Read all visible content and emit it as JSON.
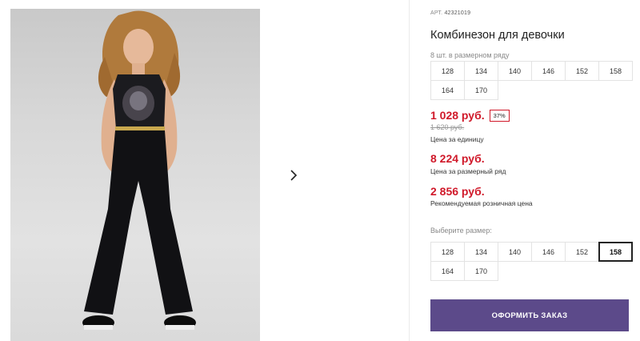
{
  "gallery": {
    "next_icon": "chevron-right-icon"
  },
  "product": {
    "art_label": "АРТ.",
    "art_number": "42321019",
    "title": "Комбинезон для девочки",
    "pack_label": "8 шт. в размерном ряду",
    "pack_sizes": [
      "128",
      "134",
      "140",
      "146",
      "152",
      "158",
      "164",
      "170"
    ]
  },
  "pricing": {
    "unit_price": "1 028 руб.",
    "discount_badge": "37%",
    "old_price": "1 620 руб.",
    "unit_caption": "Цена за единицу",
    "pack_price": "8 224 руб.",
    "pack_caption": "Цена за размерный ряд",
    "retail_price": "2 856 руб.",
    "retail_caption": "Рекомендуемая розничная цена",
    "accent_color": "#d0192a"
  },
  "size_picker": {
    "label": "Выберите размер:",
    "sizes": [
      "128",
      "134",
      "140",
      "146",
      "152",
      "158",
      "164",
      "170"
    ],
    "selected": "158"
  },
  "order": {
    "button_label": "ОФОРМИТЬ ЗАКАЗ",
    "button_color": "#5c4a8a"
  }
}
